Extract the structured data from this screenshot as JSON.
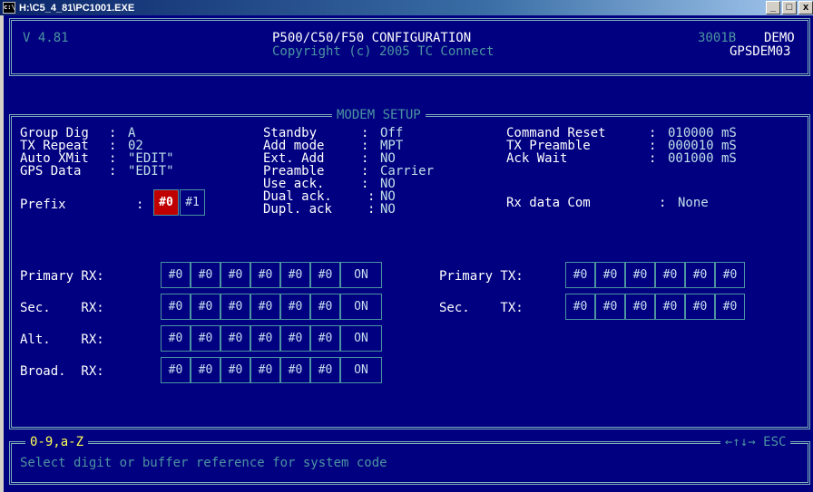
{
  "window": {
    "title": "H:\\C5_4_81\\PC1001.EXE",
    "min_label": "_",
    "max_label": "□",
    "close_label": "x"
  },
  "header": {
    "version": "V 4.81",
    "title": "P500/C50/F50 CONFIGURATION",
    "copyright": "Copyright (c) 2005 TC Connect",
    "code": "3001B",
    "mode": "DEMO",
    "device": "GPSDEM03"
  },
  "modem": {
    "legend": "MODEM SETUP",
    "left": [
      {
        "label": "Group Dig",
        "sep": ":",
        "value": "A"
      },
      {
        "label": "TX Repeat",
        "sep": ":",
        "value": "02"
      },
      {
        "label": "Auto XMit",
        "sep": ":",
        "value": "\"EDIT\""
      },
      {
        "label": "GPS Data",
        "sep": ":",
        "value": "\"EDIT\""
      }
    ],
    "middle": [
      {
        "label": "Standby",
        "sep": ":",
        "value": "Off"
      },
      {
        "label": "Add mode",
        "sep": ":",
        "value": "MPT"
      },
      {
        "label": "Ext. Add",
        "sep": ":",
        "value": "NO"
      },
      {
        "label": "Preamble",
        "sep": ":",
        "value": "Carrier"
      },
      {
        "label": "Use ack.",
        "sep": ":",
        "value": "NO"
      },
      {
        "label": "Dual ack.",
        "sep": ":",
        "value": "NO"
      },
      {
        "label": "Dupl. ack",
        "sep": ":",
        "value": "NO"
      }
    ],
    "right": [
      {
        "label": "Command Reset",
        "sep": ":",
        "value": "010000 mS"
      },
      {
        "label": "TX Preamble",
        "sep": ":",
        "value": "000010 mS"
      },
      {
        "label": "Ack Wait",
        "sep": ":",
        "value": "001000 mS"
      }
    ],
    "rx_data_com": {
      "label": "Rx data Com",
      "sep": ":",
      "value": "None"
    },
    "prefix": {
      "label": "Prefix",
      "sep": ":",
      "cells": [
        "#0",
        "#1"
      ]
    },
    "rx_rows": [
      {
        "label": "Primary RX:",
        "cells": [
          "#0",
          "#0",
          "#0",
          "#0",
          "#0",
          "#0"
        ],
        "status": "ON"
      },
      {
        "label": "Sec.    RX:",
        "cells": [
          "#0",
          "#0",
          "#0",
          "#0",
          "#0",
          "#0"
        ],
        "status": "ON"
      },
      {
        "label": "Alt.    RX:",
        "cells": [
          "#0",
          "#0",
          "#0",
          "#0",
          "#0",
          "#0"
        ],
        "status": "ON"
      },
      {
        "label": "Broad.  RX:",
        "cells": [
          "#0",
          "#0",
          "#0",
          "#0",
          "#0",
          "#0"
        ],
        "status": "ON"
      }
    ],
    "tx_rows": [
      {
        "label": "Primary TX:",
        "cells": [
          "#0",
          "#0",
          "#0",
          "#0",
          "#0",
          "#0"
        ]
      },
      {
        "label": "Sec.    TX:",
        "cells": [
          "#0",
          "#0",
          "#0",
          "#0",
          "#0",
          "#0"
        ]
      }
    ]
  },
  "footer": {
    "keys": "0-9,a-Z",
    "nav": "←↑↓→ ESC",
    "help": "Select digit or buffer reference for system code"
  },
  "colors": {
    "background": "#000080",
    "border": "#7fb0b8",
    "selected": "#c00000",
    "dim_text": "#4c94a0"
  }
}
